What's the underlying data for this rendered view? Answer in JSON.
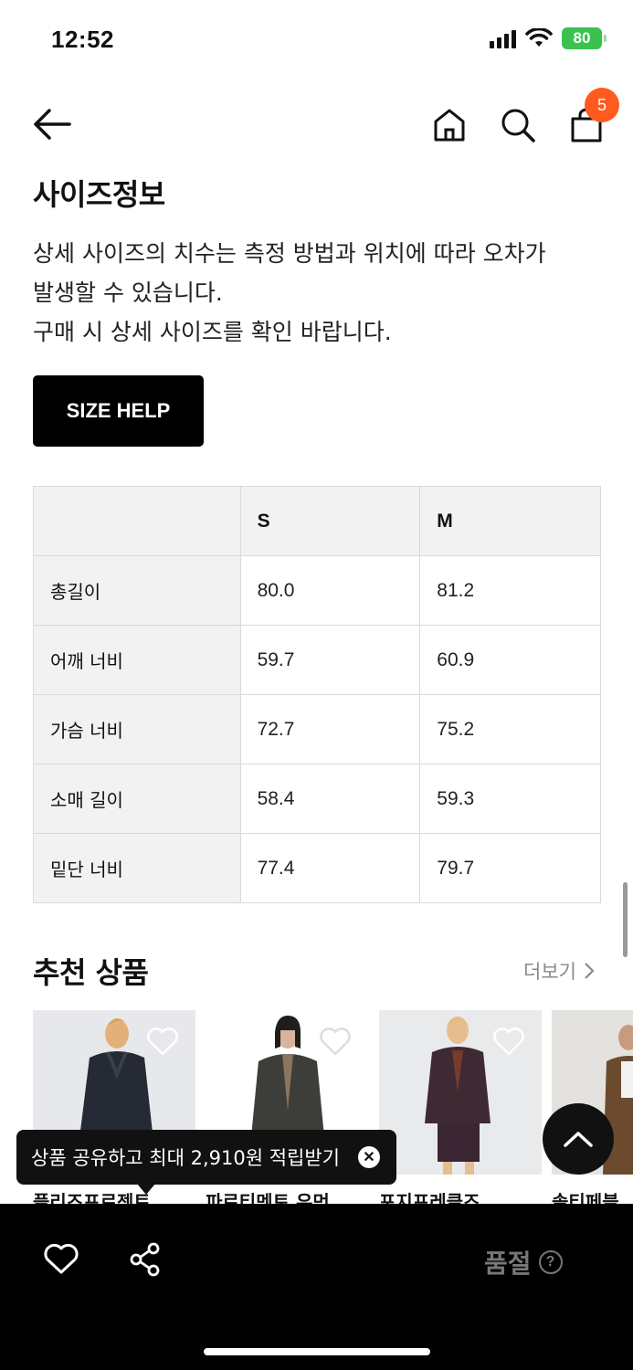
{
  "status": {
    "time": "12:52",
    "battery": "80"
  },
  "nav": {
    "cart_count": "5"
  },
  "size_info": {
    "title": "사이즈정보",
    "description": [
      "상세 사이즈의 치수는 측정 방법과 위치에 따라 오차가",
      "발생할 수 있습니다.",
      "구매 시 상세 사이즈를 확인 바랍니다."
    ],
    "help_button": "SIZE HELP",
    "table": {
      "headers": [
        "",
        "S",
        "M"
      ],
      "rows": [
        {
          "label": "총길이",
          "s": "80.0",
          "m": "81.2"
        },
        {
          "label": "어깨 너비",
          "s": "59.7",
          "m": "60.9"
        },
        {
          "label": "가슴 너비",
          "s": "72.7",
          "m": "75.2"
        },
        {
          "label": "소매 길이",
          "s": "58.4",
          "m": "59.3"
        },
        {
          "label": "밑단 너비",
          "s": "77.4",
          "m": "79.7"
        }
      ]
    }
  },
  "recommended": {
    "title": "추천 상품",
    "more_label": "더보기",
    "products": [
      {
        "brand": "플리즈프로젝트"
      },
      {
        "brand": "파르티멘토 우먼"
      },
      {
        "brand": "포지프레클즈"
      },
      {
        "brand": "솔티페블"
      }
    ]
  },
  "tooltip": {
    "text": "상품 공유하고 최대 2,910원 적립받기",
    "close": "✕"
  },
  "bottom_bar": {
    "status_label": "품절",
    "help": "?"
  },
  "colors": {
    "accent": "#ff5a1f",
    "battery": "#3cc14f"
  },
  "icons": [
    "back-icon",
    "home-icon",
    "search-icon",
    "cart-icon",
    "heart-icon",
    "share-icon",
    "chevron-up-icon",
    "chevron-right-icon",
    "close-icon"
  ]
}
